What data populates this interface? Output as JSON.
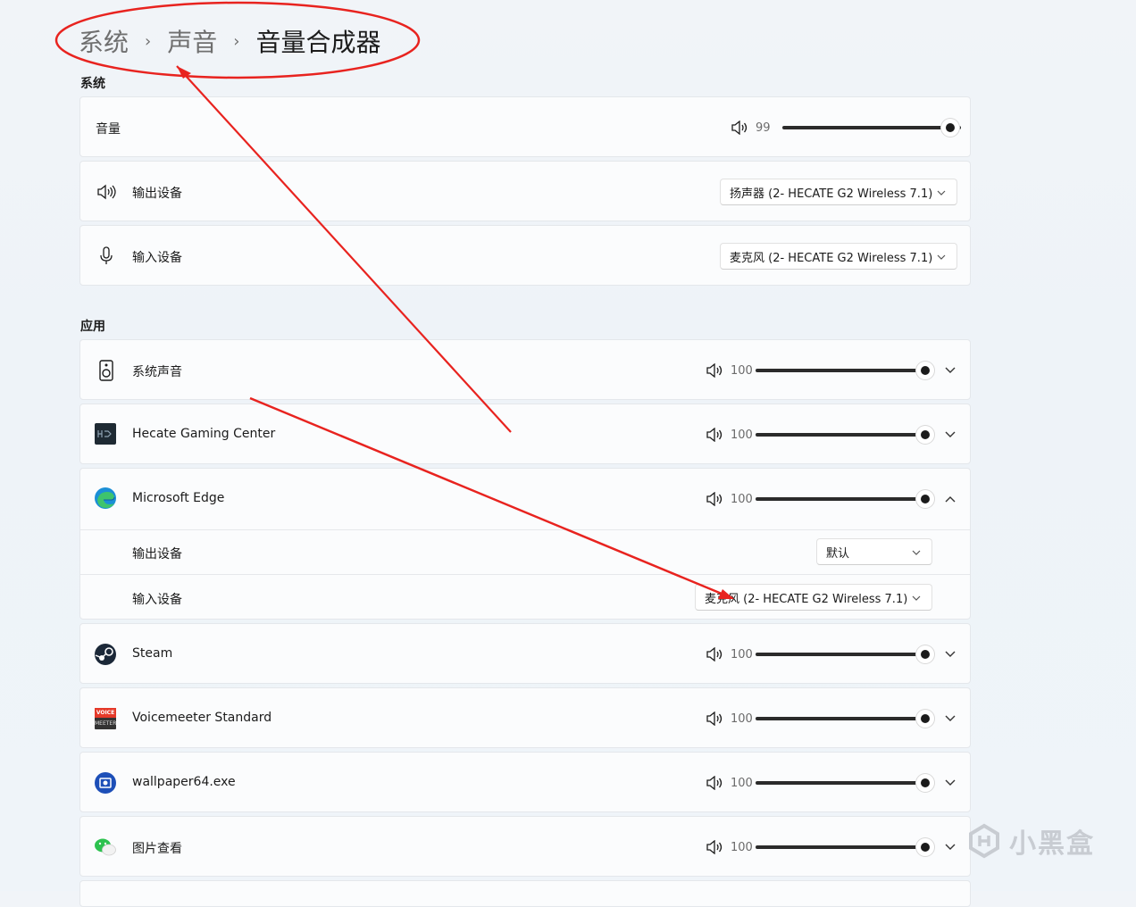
{
  "breadcrumb": {
    "items": [
      "系统",
      "声音"
    ],
    "current": "音量合成器",
    "separator": "›"
  },
  "system": {
    "title": "系统",
    "volume": {
      "label": "音量",
      "value": "99"
    },
    "output": {
      "label": "输出设备",
      "value": "扬声器 (2- HECATE G2 Wireless 7.1)"
    },
    "input": {
      "label": "输入设备",
      "value": "麦克风 (2- HECATE G2 Wireless 7.1)"
    }
  },
  "apps": {
    "title": "应用",
    "list": [
      {
        "name": "系统声音",
        "volume": "100",
        "icon": "speaker-device-icon"
      },
      {
        "name": "Hecate Gaming Center",
        "volume": "100",
        "icon": "hecate-app-icon"
      },
      {
        "name": "Microsoft Edge",
        "volume": "100",
        "icon": "edge-icon",
        "expanded": true,
        "output_label": "输出设备",
        "output_value": "默认",
        "input_label": "输入设备",
        "input_value": "麦克风 (2- HECATE G2 Wireless 7.1)"
      },
      {
        "name": "Steam",
        "volume": "100",
        "icon": "steam-icon"
      },
      {
        "name": "Voicemeeter Standard",
        "volume": "100",
        "icon": "voicemeeter-icon",
        "icon_text": [
          "VOICE",
          "MEETER"
        ]
      },
      {
        "name": "wallpaper64.exe",
        "volume": "100",
        "icon": "wallpaper-engine-icon"
      },
      {
        "name": "图片查看",
        "volume": "100",
        "icon": "wechat-icon"
      }
    ]
  },
  "volume_levels": {
    "system": 0.99,
    "apps": 1.0
  },
  "watermark": "小黑盒",
  "colors": {
    "annotation": "#e8231f",
    "accent": "#1b1b1b"
  }
}
